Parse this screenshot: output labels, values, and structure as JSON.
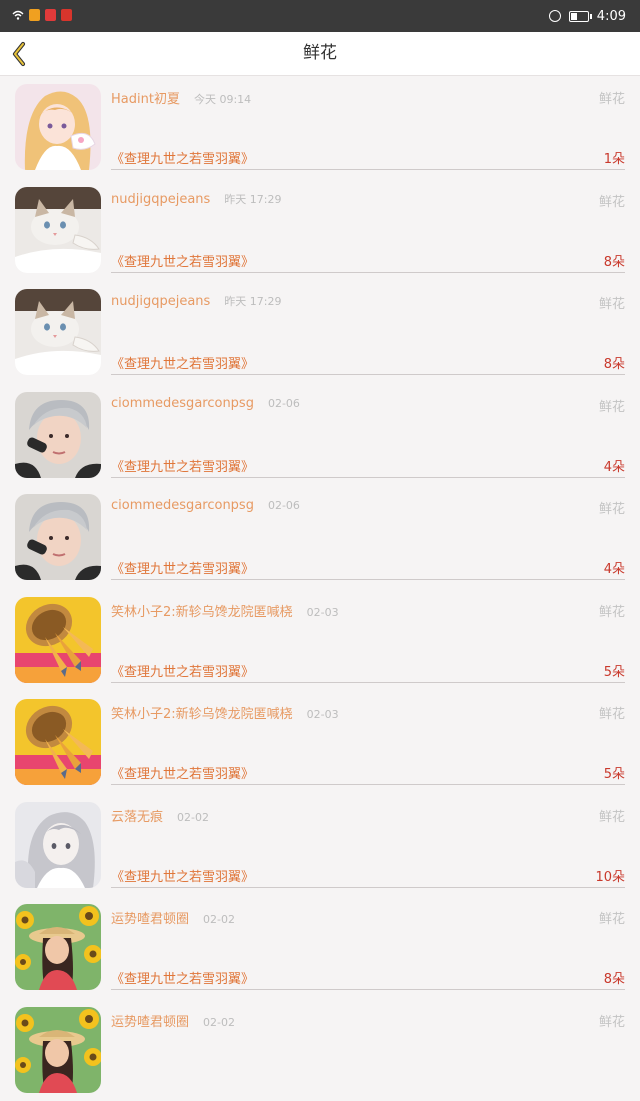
{
  "status_bar": {
    "time": "4:09",
    "battery_level": 0.35
  },
  "nav": {
    "title": "鲜花"
  },
  "colors": {
    "username": "#e79a63",
    "book_title": "#e0763a",
    "flower_count": "#c9392c",
    "category": "#c3c3c3",
    "timestamp": "#bdbdbd"
  },
  "rows": [
    {
      "avatar": "anime-girl-avatar",
      "user": "Hadint初夏",
      "time": "今天 09:14",
      "category": "鲜花",
      "book": "《查理九世之若雪羽翼》",
      "count": "1朵"
    },
    {
      "avatar": "kitten-avatar",
      "user": "nudjigqpejeans",
      "time": "昨天 17:29",
      "category": "鲜花",
      "book": "《查理九世之若雪羽翼》",
      "count": "8朵"
    },
    {
      "avatar": "kitten-avatar",
      "user": "nudjigqpejeans",
      "time": "昨天 17:29",
      "category": "鲜花",
      "book": "《查理九世之若雪羽翼》",
      "count": "8朵"
    },
    {
      "avatar": "silver-hair-man-avatar",
      "user": "ciommedesgarconpsg",
      "time": "02-06",
      "category": "鲜花",
      "book": "《查理九世之若雪羽翼》",
      "count": "4朵"
    },
    {
      "avatar": "silver-hair-man-avatar",
      "user": "ciommedesgarconpsg",
      "time": "02-06",
      "category": "鲜花",
      "book": "《查理九世之若雪羽翼》",
      "count": "4朵"
    },
    {
      "avatar": "cartoon-pencils-avatar",
      "user": "笑林小子2:新轸乌馋龙院匿喊桡",
      "time": "02-03",
      "category": "鲜花",
      "book": "《查理九世之若雪羽翼》",
      "count": "5朵"
    },
    {
      "avatar": "cartoon-pencils-avatar",
      "user": "笑林小子2:新轸乌馋龙院匿喊桡",
      "time": "02-03",
      "category": "鲜花",
      "book": "《查理九世之若雪羽翼》",
      "count": "5朵"
    },
    {
      "avatar": "grey-anime-girl-avatar",
      "user": "云落无痕",
      "time": "02-02",
      "category": "鲜花",
      "book": "《查理九世之若雪羽翼》",
      "count": "10朵"
    },
    {
      "avatar": "sunflower-girl-avatar",
      "user": "运势喳君顿圈",
      "time": "02-02",
      "category": "鲜花",
      "book": "《查理九世之若雪羽翼》",
      "count": "8朵"
    },
    {
      "avatar": "sunflower-girl-avatar",
      "user": "运势喳君顿圈",
      "time": "02-02",
      "category": "鲜花",
      "book": "",
      "count": ""
    }
  ]
}
